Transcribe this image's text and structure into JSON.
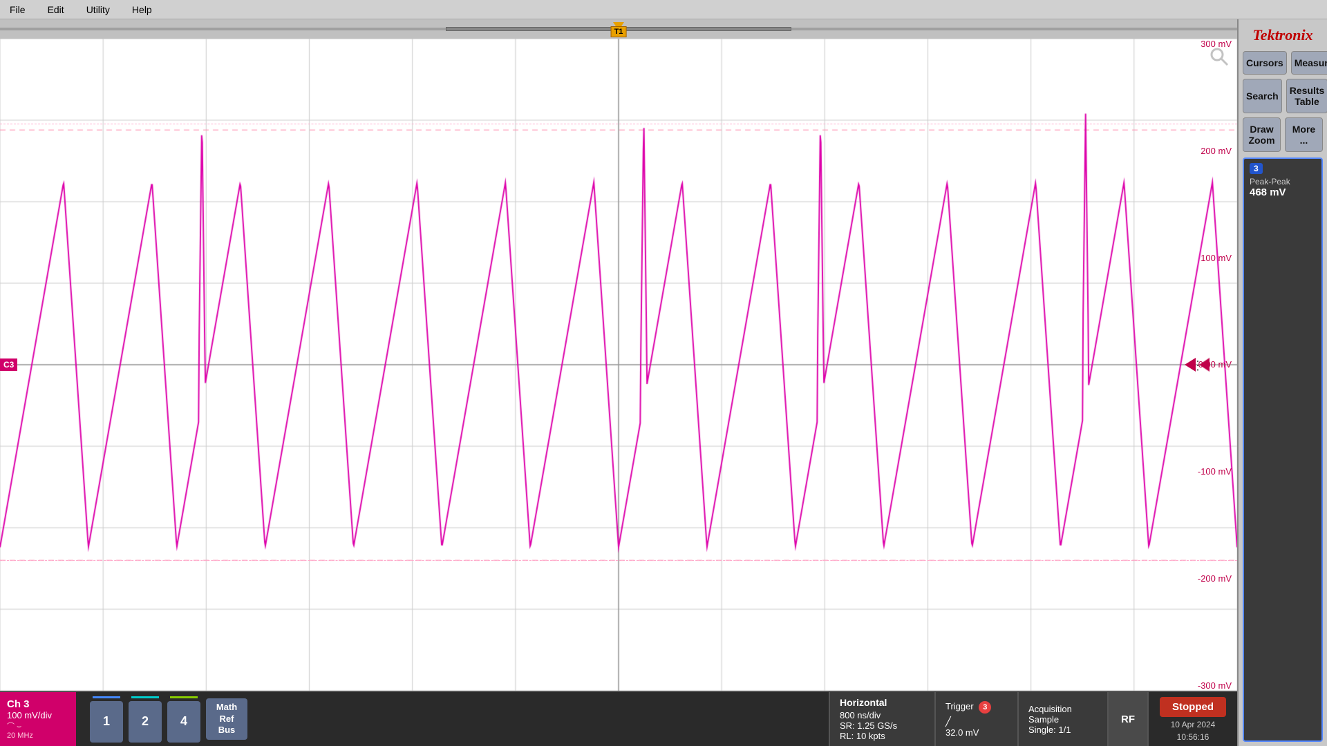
{
  "brand": "Tektronix",
  "menu": {
    "items": [
      "File",
      "Edit",
      "Utility",
      "Help"
    ]
  },
  "right_panel": {
    "cursors_label": "Cursors",
    "measure_label": "Measure",
    "search_label": "Search",
    "results_table_label": "Results Table",
    "draw_zoom_label": "Draw Zoom",
    "more_label": "More ...",
    "measurement": {
      "badge": "3",
      "label": "Peak-Peak",
      "value": "468 mV"
    }
  },
  "waveform": {
    "y_labels": [
      "300 mV",
      "200 mV",
      "100 mV",
      "0.00 mV",
      "-100 mV",
      "-200 mV",
      "-300 mV"
    ],
    "ch3_label": "C3",
    "trigger_badge": "T1"
  },
  "bottom_bar": {
    "ch3": {
      "name": "Ch 3",
      "scale": "100 mV/div",
      "bw": "20 MHz",
      "icons": "⌒  ⌣"
    },
    "channels": {
      "btn1": "1",
      "btn2": "2",
      "btn4": "4",
      "math_ref_bus": "Math\nRef\nBus"
    },
    "horizontal": {
      "title": "Horizontal",
      "time_div": "800 ns/div",
      "sr": "SR: 1.25 GS/s",
      "rl": "RL: 10 kpts"
    },
    "trigger": {
      "title": "Trigger",
      "badge": "3",
      "level": "32.0 mV"
    },
    "acquisition": {
      "title": "Acquisition",
      "mode": "Sample",
      "single": "Single: 1/1"
    },
    "rf_label": "RF",
    "stopped_label": "Stopped",
    "date": "10 Apr 2024",
    "time": "10:56:16"
  }
}
